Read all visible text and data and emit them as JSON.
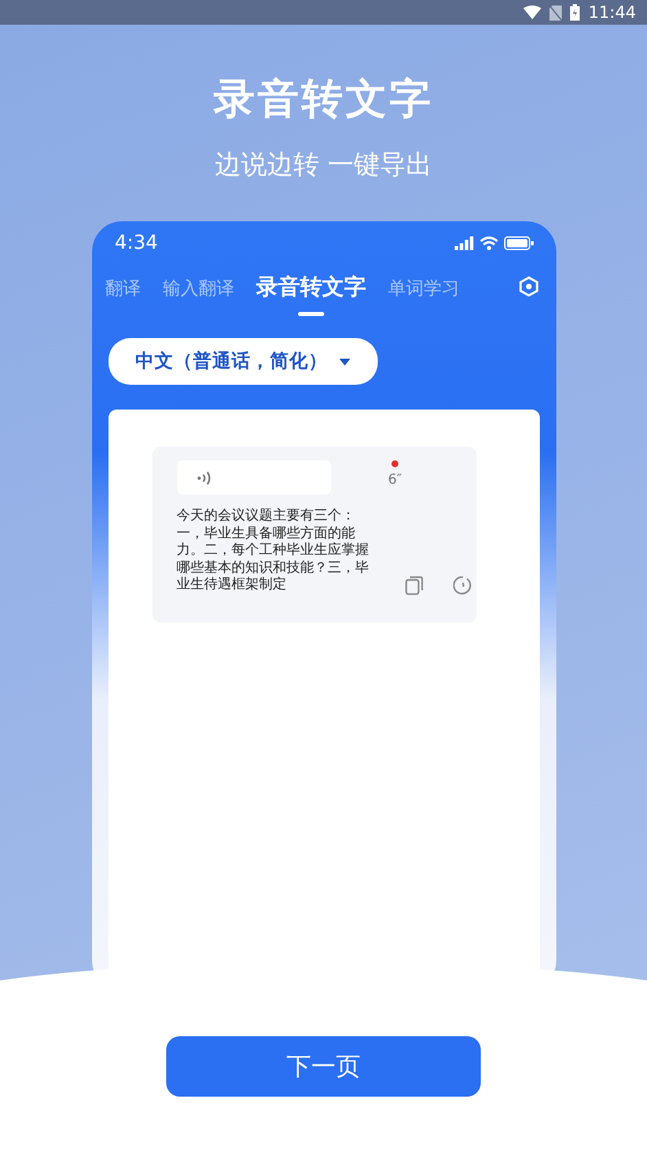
{
  "status_bar": {
    "time": "11:44"
  },
  "headline": {
    "title": "录音转文字",
    "subtitle": "边说边转 一键导出"
  },
  "phone": {
    "time": "4:34",
    "tabs": [
      {
        "label": "翻译",
        "selected": false
      },
      {
        "label": "输入翻译",
        "selected": false
      },
      {
        "label": "录音转文字",
        "selected": true
      },
      {
        "label": "单词学习",
        "selected": false
      }
    ],
    "language_selector": {
      "value": "中文（普通话，简化）"
    },
    "recording": {
      "duration": "6″",
      "recording": true,
      "transcript": "今天的会议议题主要有三个：一，毕业生具备哪些方面的能力。二，每个工种毕业生应掌握哪些基本的知识和技能？三，毕业生待遇框架制定"
    }
  },
  "next_button": {
    "label": "下一页"
  }
}
